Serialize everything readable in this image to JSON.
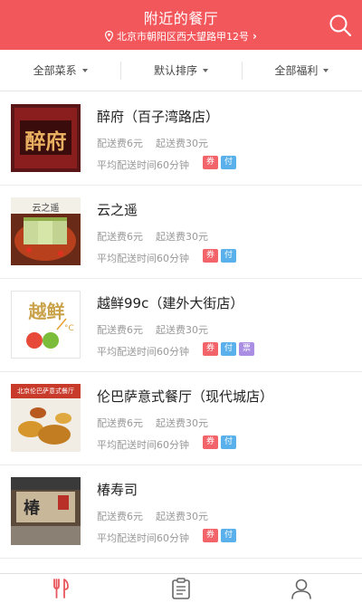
{
  "header": {
    "title": "附近的餐厅",
    "address": "北京市朝阳区西大望路甲12号",
    "chevron": "›",
    "bg_color": "#f2575c"
  },
  "filters": [
    {
      "label": "全部菜系"
    },
    {
      "label": "默认排序"
    },
    {
      "label": "全部福利"
    }
  ],
  "restaurants": [
    {
      "name": "醉府（百子湾路店）",
      "delivery_fee": "配送费6元",
      "min_order": "起送费30元",
      "avg_time": "平均配送时间60分钟",
      "logo_text": "醉府"
    },
    {
      "name": "云之遥",
      "delivery_fee": "配送费6元",
      "min_order": "起送费30元",
      "avg_time": "平均配送时间60分钟",
      "logo_text": "云之遥"
    },
    {
      "name": "越鲜99c（建外大街店）",
      "delivery_fee": "配送费6元",
      "min_order": "起送费30元",
      "avg_time": "平均配送时间60分钟",
      "logo_text": "越鲜",
      "logo_sub": "°C"
    },
    {
      "name": "伦巴萨意式餐厅（现代城店）",
      "delivery_fee": "配送费6元",
      "min_order": "起送费30元",
      "avg_time": "平均配送时间60分钟",
      "logo_text": "北京伦巴萨意式餐厅"
    },
    {
      "name": "椿寿司",
      "delivery_fee": "配送费6元",
      "min_order": "起送费30元",
      "avg_time": "平均配送时间60分钟",
      "logo_text": "椿"
    }
  ],
  "badges": {
    "quan": "券",
    "fu": "付",
    "piao": "票"
  },
  "tabbar": {
    "tabs": [
      {
        "icon": "fork-knife-icon",
        "active": true
      },
      {
        "icon": "clipboard-icon",
        "active": false
      },
      {
        "icon": "user-icon",
        "active": false
      }
    ],
    "active_color": "#e8555b"
  }
}
